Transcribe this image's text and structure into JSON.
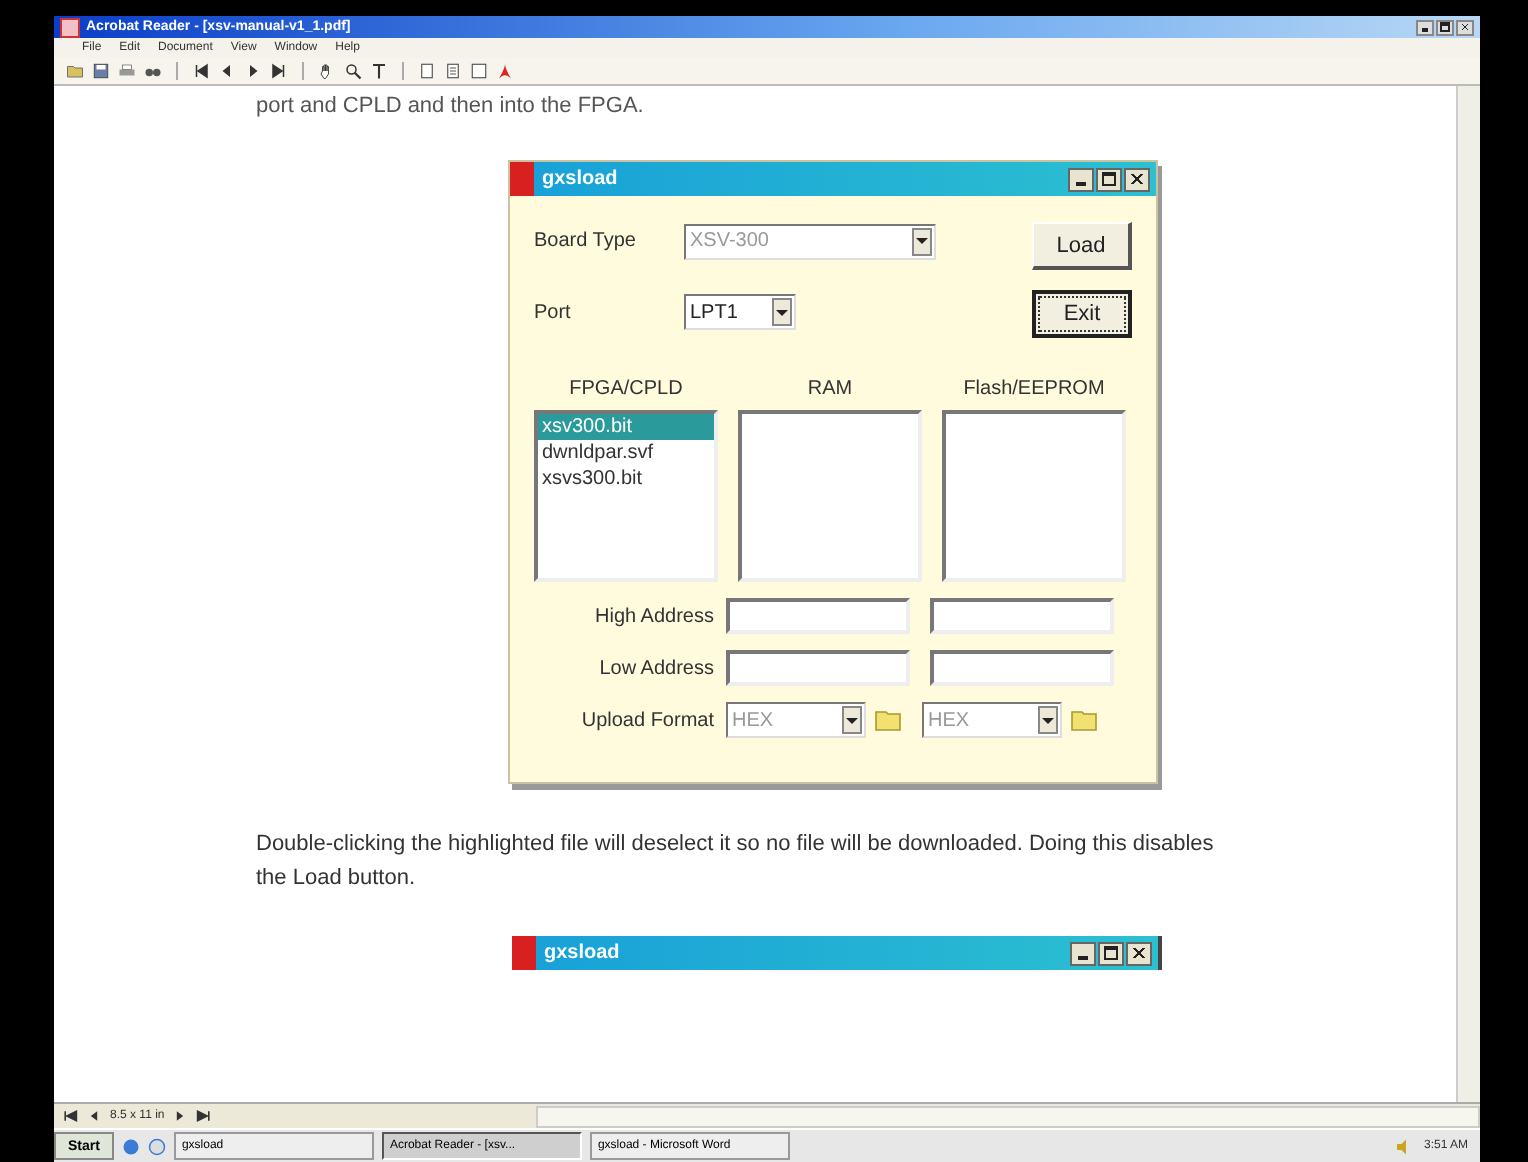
{
  "app_window": {
    "title": "Acrobat Reader - [xsv-manual-v1_1.pdf]",
    "menu": [
      "File",
      "Edit",
      "Document",
      "View",
      "Window",
      "Help"
    ]
  },
  "document": {
    "text_before": "port and CPLD and then into the FPGA.",
    "dialog": {
      "title": "gxsload",
      "board_type": {
        "label": "Board Type",
        "value": "XSV-300",
        "disabled": true
      },
      "port": {
        "label": "Port",
        "value": "LPT1",
        "disabled": false
      },
      "buttons": [
        {
          "label": "Load",
          "focused": false
        },
        {
          "label": "Exit",
          "focused": true
        }
      ],
      "columns": [
        {
          "heading": "FPGA/CPLD",
          "files": [
            {
              "name": "xsv300.bit",
              "selected": true
            },
            {
              "name": "dwnldpar.svf",
              "selected": false
            },
            {
              "name": "xsvs300.bit",
              "selected": false
            }
          ]
        },
        {
          "heading": "RAM"
        },
        {
          "heading": "Flash/EEPROM"
        }
      ],
      "address_rows": [
        {
          "label": "High Address"
        },
        {
          "label": "Low Address"
        }
      ],
      "upload_format": {
        "label": "Upload Format",
        "selects": [
          {
            "value": "HEX",
            "disabled": true
          },
          {
            "value": "HEX",
            "disabled": true
          }
        ]
      }
    },
    "paragraph": "Double-clicking the highlighted file will deselect it so no file will be downloaded.  Doing this disables the Load button.",
    "second_dialog": {
      "title": "gxsload"
    }
  },
  "status_bar": {
    "page_size": "8.5 x 11 in"
  },
  "taskbar": {
    "start": "Start",
    "tasks": [
      {
        "label": "gxsload",
        "selected": false
      },
      {
        "label": "Acrobat Reader - [xsv...",
        "selected": true
      },
      {
        "label": "gxsload - Microsoft Word",
        "selected": false
      }
    ],
    "clock": "3:51 AM"
  }
}
